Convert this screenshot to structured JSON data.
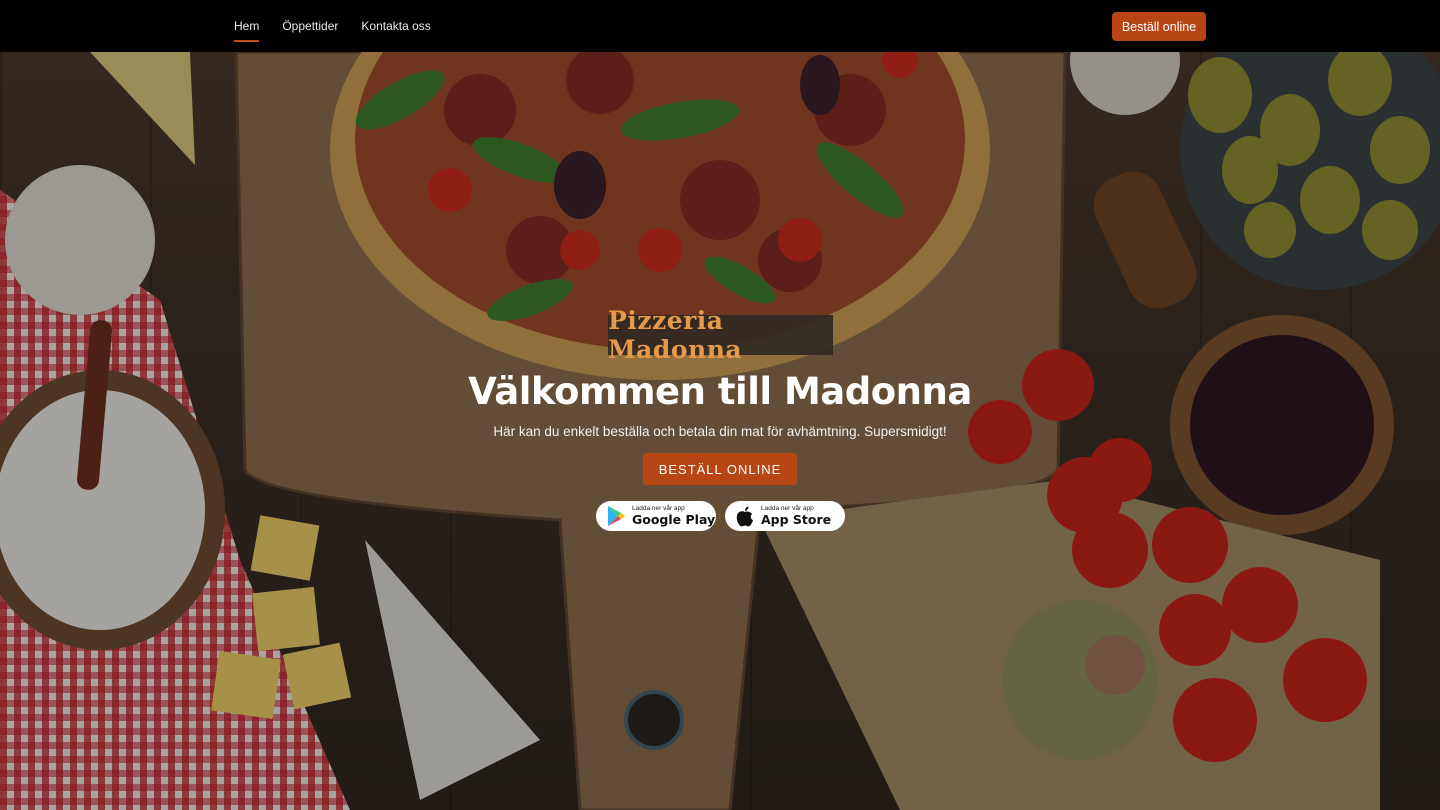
{
  "nav": {
    "items": [
      {
        "label": "Hem",
        "active": true
      },
      {
        "label": "Öppettider",
        "active": false
      },
      {
        "label": "Kontakta oss",
        "active": false
      }
    ],
    "order_button": "Beställ online"
  },
  "hero": {
    "brand": "Pizzeria Madonna",
    "title": "Välkommen till Madonna",
    "subtitle": "Här kan du enkelt beställa och betala din mat för avhämtning. Supersmidigt!",
    "cta": "BESTÄLL ONLINE",
    "stores": [
      {
        "small": "Ladda ner vår app",
        "name": "Google Play",
        "icon": "google-play-icon"
      },
      {
        "small": "Ladda ner vår app",
        "name": "App Store",
        "icon": "apple-icon"
      }
    ]
  },
  "colors": {
    "accent": "#b84614",
    "brand_text": "#e59a4b",
    "topbar": "#000000"
  }
}
